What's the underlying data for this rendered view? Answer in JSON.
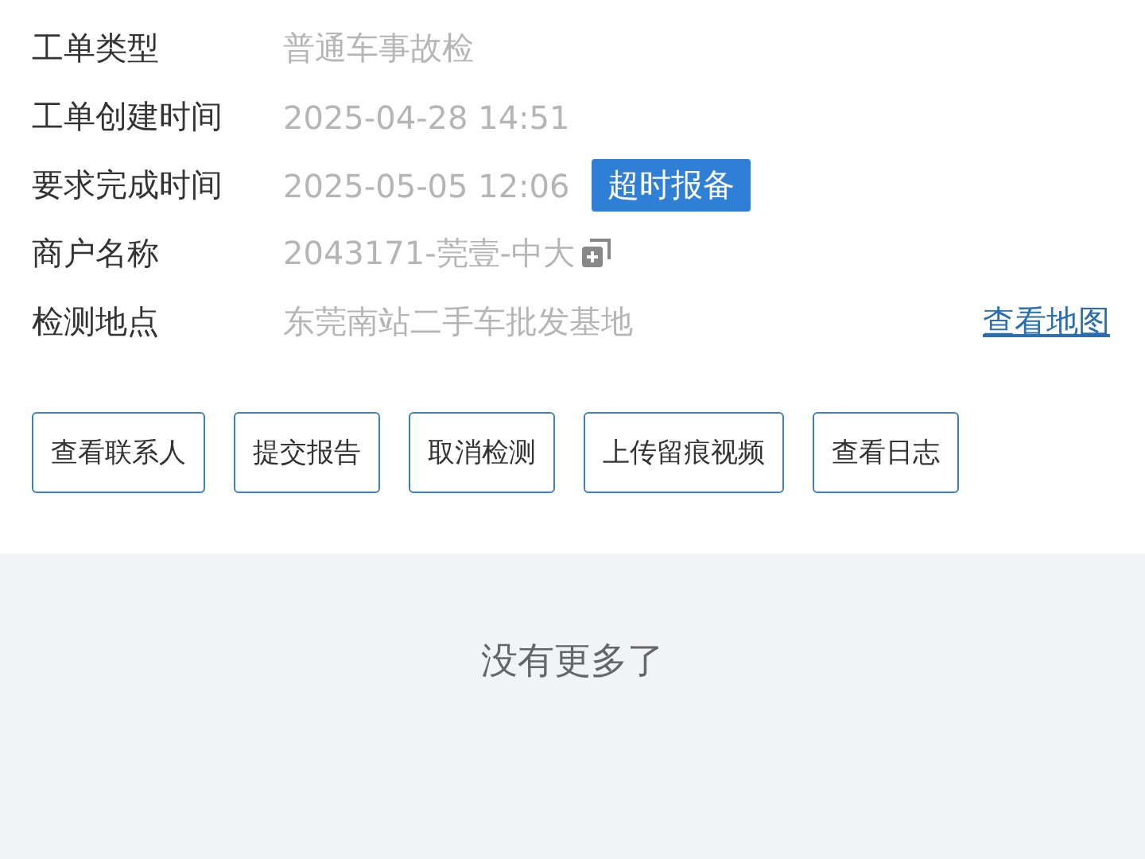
{
  "details": [
    {
      "label": "工单类型",
      "value": "普通车事故检"
    },
    {
      "label": "工单创建时间",
      "value": "2025-04-28 14:51"
    },
    {
      "label": "要求完成时间",
      "value": "2025-05-05 12:06",
      "badge": "超时报备"
    },
    {
      "label": "商户名称",
      "value": "2043171-莞壹-中大",
      "copy": true
    },
    {
      "label": "检测地点",
      "value": "东莞南站二手车批发基地",
      "link": "查看地图"
    }
  ],
  "actions": [
    "查看联系人",
    "提交报告",
    "取消检测",
    "上传留痕视频",
    "查看日志"
  ],
  "footer": "没有更多了"
}
